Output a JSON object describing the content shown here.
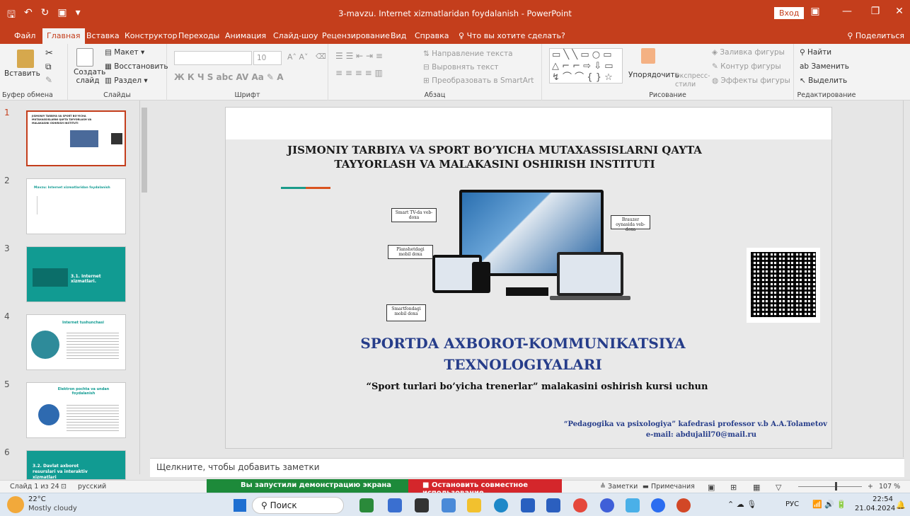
{
  "titlebar": {
    "title": "3-mavzu. Internet xizmatlaridan foydalanish  -  PowerPoint",
    "login": "Вход",
    "minimize": "—",
    "restore": "❐",
    "close": "✕",
    "ribbon_display": "▣"
  },
  "tabs": [
    "Файл",
    "Главная",
    "Вставка",
    "Конструктор",
    "Переходы",
    "Анимация",
    "Слайд-шоу",
    "Рецензирование",
    "Вид",
    "Справка"
  ],
  "tell_me": "Что вы хотите сделать?",
  "share": "Поделиться",
  "ribbon": {
    "clipboard": {
      "paste": "Вставить",
      "label": "Буфер обмена"
    },
    "slides": {
      "new_slide": "Создать слайд",
      "layout": "Макет",
      "reset": "Восстановить",
      "section": "Раздел",
      "label": "Слайды"
    },
    "font": {
      "size": "10",
      "label": "Шрифт"
    },
    "paragraph": {
      "text_direction": "Направление текста",
      "align_text": "Выровнять текст",
      "smartart": "Преобразовать в SmartArt",
      "label": "Абзац"
    },
    "drawing": {
      "arrange": "Упорядочить",
      "quick_styles": "Экспресс-стили",
      "fill": "Заливка фигуры",
      "outline": "Контур фигуры",
      "effects": "Эффекты фигуры",
      "label": "Рисование"
    },
    "editing": {
      "find": "Найти",
      "replace": "Заменить",
      "select": "Выделить",
      "label": "Редактирование"
    }
  },
  "thumbnails": [
    {
      "num": "1",
      "text": "JISMONIY TARBIYA VA SPORT BO'YICHA MUTAXASSISLARNI QAYTA TAYYORLASH VA MALAKASINI OSHIRISH INSTITUTI"
    },
    {
      "num": "2",
      "text": "Mavzu: Internet xizmatlaridan foydalanish"
    },
    {
      "num": "3",
      "text": "3.1. Internet xizmatlari."
    },
    {
      "num": "4",
      "text": "Internet tushunchasi"
    },
    {
      "num": "5",
      "text": "Elektron pochta va undan foydalanish"
    },
    {
      "num": "6",
      "text": "3.2. Davlat axborot resurslari va interaktiv xizmatlari"
    }
  ],
  "slide": {
    "institute": "JISMONIY TARBIYA VA SPORT BO’YICHA MUTAXASSISLARNI QAYTA TAYYORLASH VA MALAKASINI OSHIRISH INSTITUTI",
    "main_title": "SPORTDA AXBOROT-KOMMUNIKATSIYA TEXNOLOGIYALARI",
    "subtitle": "“Sport turlari bo’yicha trenerlar” malakasini oshirish kursi uchun",
    "professor": "“Pedagogika va psixologiya” kafedrasi professor v.b   A.A.Tolametov",
    "email": "e-mail:  abdujalil70@mail.ru",
    "callouts": [
      "Smart TV-da veb-doxa",
      "Planshetdagi mobil doxa",
      "Smartfondagi mobil doxa",
      "Brauzer oynasida veb-doxa"
    ]
  },
  "notes_placeholder": "Щелкните, чтобы добавить заметки",
  "status": {
    "slide_of": "Слайд 1 из 24",
    "language": "русский",
    "notes": "Заметки",
    "comments": "Примечания",
    "zoom": "107 %"
  },
  "share_bar": {
    "running": "Вы запустили демонстрацию экрана",
    "stop": "Остановить совместное использование"
  },
  "taskbar": {
    "temp": "22°C",
    "weather": "Mostly cloudy",
    "search": "Поиск",
    "lang": "РУС",
    "time": "22:54",
    "date": "21.04.2024"
  }
}
